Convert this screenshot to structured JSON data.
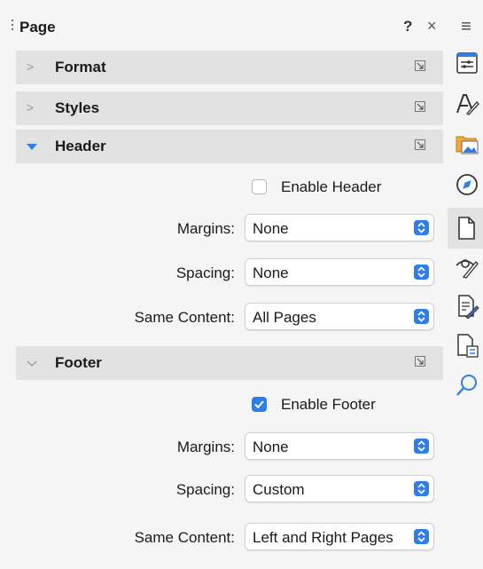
{
  "deck": {
    "title": "Page",
    "help": "?",
    "close": "×",
    "menu": "≡"
  },
  "sections": {
    "format": {
      "title": "Format"
    },
    "styles": {
      "title": "Styles"
    },
    "header": {
      "title": "Header",
      "enable_label": "Enable Header",
      "enabled": false,
      "margins_label": "Margins:",
      "margins_value": "None",
      "spacing_label": "Spacing:",
      "spacing_value": "None",
      "same_content_label": "Same Content:",
      "same_content_value": "All Pages"
    },
    "footer": {
      "title": "Footer",
      "enable_label": "Enable Footer",
      "enabled": true,
      "margins_label": "Margins:",
      "margins_value": "None",
      "spacing_label": "Spacing:",
      "spacing_value": "Custom",
      "same_content_label": "Same Content:",
      "same_content_value": "Left and Right Pages"
    }
  },
  "sidebar_tabs": [
    {
      "name": "properties-icon"
    },
    {
      "name": "styles-icon"
    },
    {
      "name": "gallery-icon"
    },
    {
      "name": "navigator-icon"
    },
    {
      "name": "page-icon",
      "active": true
    },
    {
      "name": "style-inspector-icon"
    },
    {
      "name": "manage-changes-icon"
    },
    {
      "name": "design-icon"
    },
    {
      "name": "find-icon"
    }
  ],
  "colors": {
    "accent": "#2f7ee7",
    "section_bg": "#e2e2e2",
    "panel_bg": "#f5f5f5"
  }
}
